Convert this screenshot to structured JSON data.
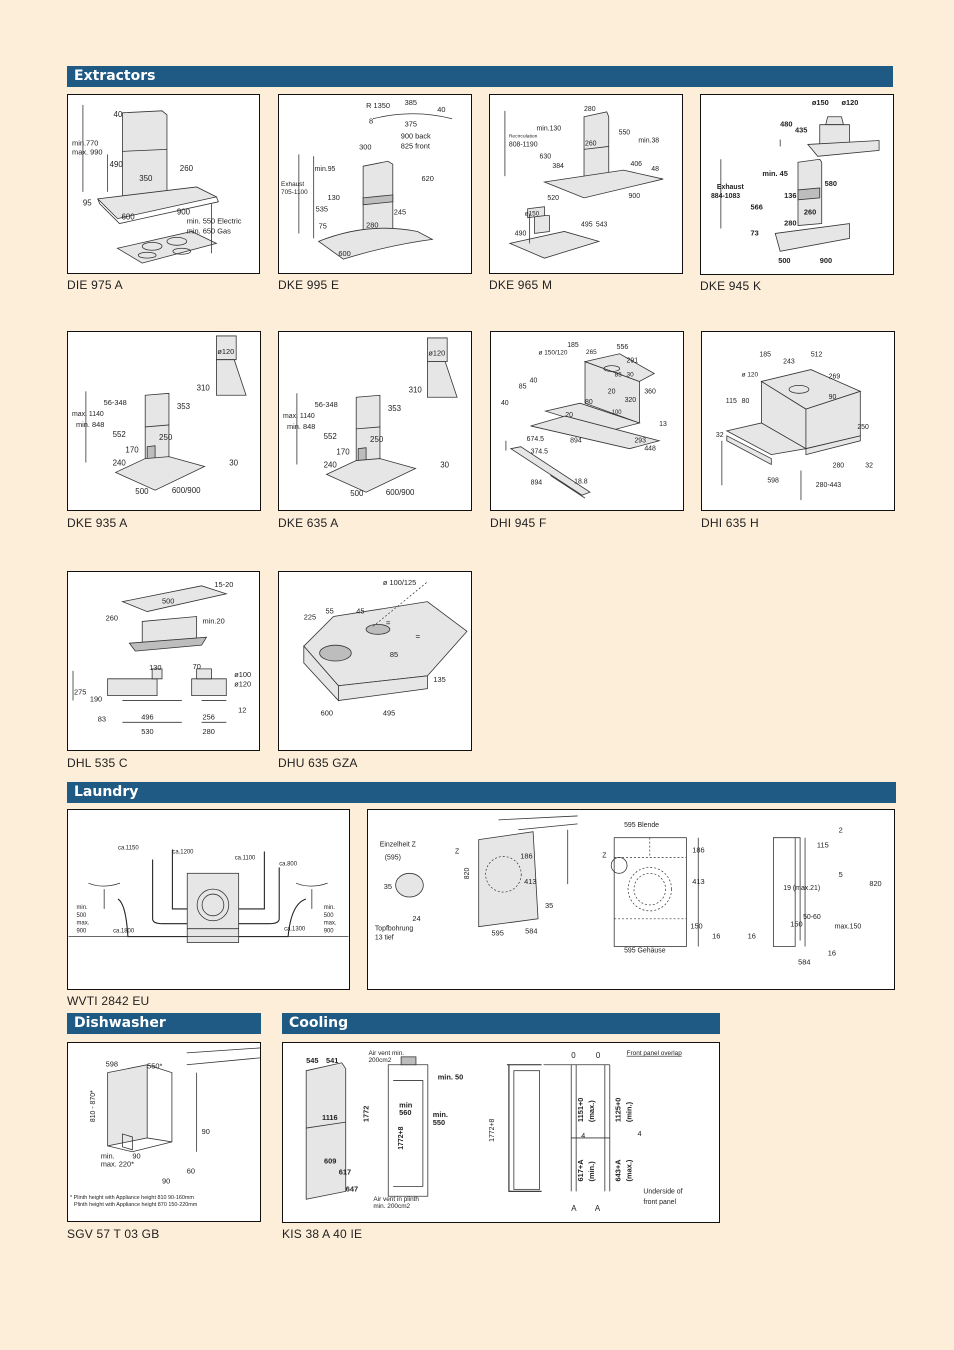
{
  "sections": {
    "extractors": "Extractors",
    "laundry": "Laundry",
    "dishwasher": "Dishwasher",
    "cooling": "Cooling"
  },
  "extractors": [
    {
      "model": "DIE 975 A",
      "labels": [
        "40",
        "min.770",
        "max. 990",
        "490",
        "260",
        "350",
        "95",
        "600",
        "900",
        "min. 550 Electric",
        "min. 650 Gas"
      ]
    },
    {
      "model": "DKE 995 E",
      "labels": [
        "R 1350",
        "385",
        "40",
        "8",
        "375",
        "900 back",
        "825 front",
        "300",
        "min.95",
        "620",
        "Exhaust",
        "705-1100",
        "130",
        "535",
        "245",
        "280",
        "75",
        "600"
      ]
    },
    {
      "model": "DKE 965 M",
      "labels": [
        "280",
        "min.130",
        "550",
        "Recirculation",
        "808-1190",
        "260",
        "min.38",
        "630",
        "384",
        "406",
        "48",
        "520",
        "900",
        "ø150",
        "490",
        "495",
        "543"
      ]
    },
    {
      "model": "DKE 945 K",
      "labels": [
        "ø150",
        "ø120",
        "480",
        "435",
        "min. 45",
        "580",
        "Exhaust",
        "884-1083",
        "136",
        "566",
        "260",
        "280",
        "73",
        "500",
        "900"
      ]
    },
    {
      "model": "DKE 935 A",
      "labels": [
        "ø120",
        "310",
        "56-348",
        "353",
        "max. 1140",
        "min. 848",
        "552",
        "250",
        "170",
        "240",
        "30",
        "500",
        "600/900"
      ]
    },
    {
      "model": "DKE 635 A",
      "labels": [
        "ø120",
        "310",
        "56-348",
        "353",
        "max. 1140",
        "min. 848",
        "552",
        "250",
        "170",
        "240",
        "30",
        "500",
        "600/900"
      ]
    },
    {
      "model": "DHI 945 F",
      "labels": [
        "185",
        "556",
        "ø 150/120",
        "265",
        "291",
        "85",
        "40",
        "85",
        "30",
        "360",
        "20",
        "320",
        "40",
        "80",
        "20",
        "100",
        "13",
        "674.5",
        "894",
        "293",
        "448",
        "374.5",
        "894",
        "18.8"
      ]
    },
    {
      "model": "DHI 635 H",
      "labels": [
        "185",
        "512",
        "243",
        "ø 120",
        "269",
        "115",
        "80",
        "90",
        "250",
        "32",
        "280",
        "32",
        "598",
        "280-443"
      ]
    },
    {
      "model": "DHL 535 C",
      "labels": [
        "15-20",
        "500",
        "260",
        "min.20",
        "130",
        "70",
        "ø100",
        "ø120",
        "275",
        "190",
        "12",
        "83",
        "496",
        "256",
        "530",
        "280"
      ]
    },
    {
      "model": "DHU 635 GZA",
      "labels": [
        "ø 100/125",
        "225",
        "55",
        "45",
        "=",
        "=",
        "85",
        "135",
        "600",
        "495"
      ]
    }
  ],
  "laundry": {
    "model": "WVTI 2842 EU",
    "left_labels": [
      "ca.1150",
      "ca.1200",
      "ca.1100",
      "ca.800",
      "min.",
      "500",
      "max.",
      "900",
      "ca.1800",
      "ca.1300",
      "min.",
      "500",
      "max.",
      "900"
    ],
    "right_labels": [
      "Einzelheit Z",
      "(595)",
      "35",
      "24",
      "Topfbohrung",
      "13 tief",
      "Z",
      "820",
      "186",
      "413",
      "35",
      "595",
      "584",
      "595 Blende",
      "Z",
      "186",
      "413",
      "150",
      "16",
      "595 Gehäuse",
      "2",
      "115",
      "5",
      "820",
      "19 (max.21)",
      "50-60",
      "150",
      "max.150",
      "16",
      "16",
      "584"
    ]
  },
  "dishwasher": {
    "model": "SGV 57 T 03 GB",
    "labels": [
      "598",
      "550*",
      "810 - 870*",
      "90",
      "min.",
      "90",
      "max. 220*",
      "60",
      "90"
    ],
    "footnote_1": "* Plinth height with Appliance height 810 90-160mm",
    "footnote_2": "Plinth height with Appliance height 870 150-220mm"
  },
  "cooling": {
    "model": "KIS 38 A 40 IE",
    "labels": [
      "545",
      "541",
      "Air vent min.",
      "200cm2",
      "min. 50",
      "1772",
      "1116",
      "min",
      "560",
      "min.",
      "550",
      "1772+8",
      "609",
      "617",
      "647",
      "Air vent in plinth",
      "min. 200cm2",
      "0",
      "0",
      "Front panel overlap",
      "1772+8",
      "1151+0",
      "(max.)",
      "1125+0",
      "(min.)",
      "4",
      "4",
      "617+A",
      "(min.)",
      "643+A",
      "(max.)",
      "Underside of",
      "front panel",
      "A",
      "A"
    ]
  }
}
